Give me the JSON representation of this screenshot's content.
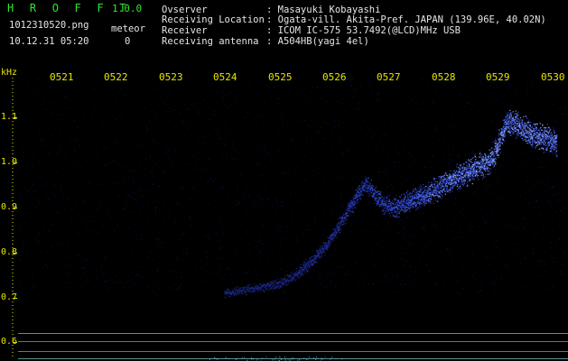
{
  "header": {
    "app_title": "H R O F F T",
    "version": "1.0.0",
    "filename": "1012310520.png",
    "datetime": "10.12.31 05:20",
    "meteor_label": "meteor",
    "meteor_count": "0"
  },
  "station_info": {
    "rows": [
      {
        "label": "Ovserver",
        "value": ": Masayuki Kobayashi"
      },
      {
        "label": "Receiving Location",
        "value": ": Ogata-vill. Akita-Pref. JAPAN (139.96E, 40.02N)"
      },
      {
        "label": "Receiver",
        "value": ": ICOM IC-575 53.7492(@LCD)MHz USB"
      },
      {
        "label": "Receiving antenna",
        "value": ": A504HB(yagi 4el)"
      }
    ]
  },
  "colors": {
    "title_green": "#2ee62e",
    "info_white": "#e6e6e6",
    "axis_yellow": "#e6e600",
    "background": "#000000",
    "signal_blue": "#4060ff"
  },
  "chart_data": {
    "type": "heatmap",
    "y_unit": "kHz",
    "x_ticks": [
      "0521",
      "0522",
      "0523",
      "0524",
      "0525",
      "0526",
      "0527",
      "0528",
      "0529",
      "0530"
    ],
    "y_ticks": [
      "1.1",
      "1.0",
      "0.9",
      "0.8",
      "0.7",
      "0.6"
    ],
    "y_range": [
      0.58,
      1.16
    ],
    "x_range": [
      520.5,
      530.2
    ],
    "signal_trace": {
      "x": [
        524.0,
        524.5,
        525.0,
        525.3,
        525.6,
        525.9,
        526.1,
        526.3,
        526.5,
        526.6,
        526.75,
        526.9,
        527.1,
        527.4,
        527.7,
        528.0,
        528.3,
        528.6,
        528.85,
        529.0,
        529.1,
        529.2,
        529.35,
        529.5,
        529.7,
        529.9,
        530.1
      ],
      "y": [
        0.71,
        0.72,
        0.73,
        0.75,
        0.78,
        0.82,
        0.86,
        0.9,
        0.94,
        0.956,
        0.93,
        0.91,
        0.9,
        0.915,
        0.93,
        0.95,
        0.97,
        0.99,
        1.0,
        1.03,
        1.07,
        1.09,
        1.085,
        1.075,
        1.06,
        1.055,
        1.045
      ]
    }
  }
}
